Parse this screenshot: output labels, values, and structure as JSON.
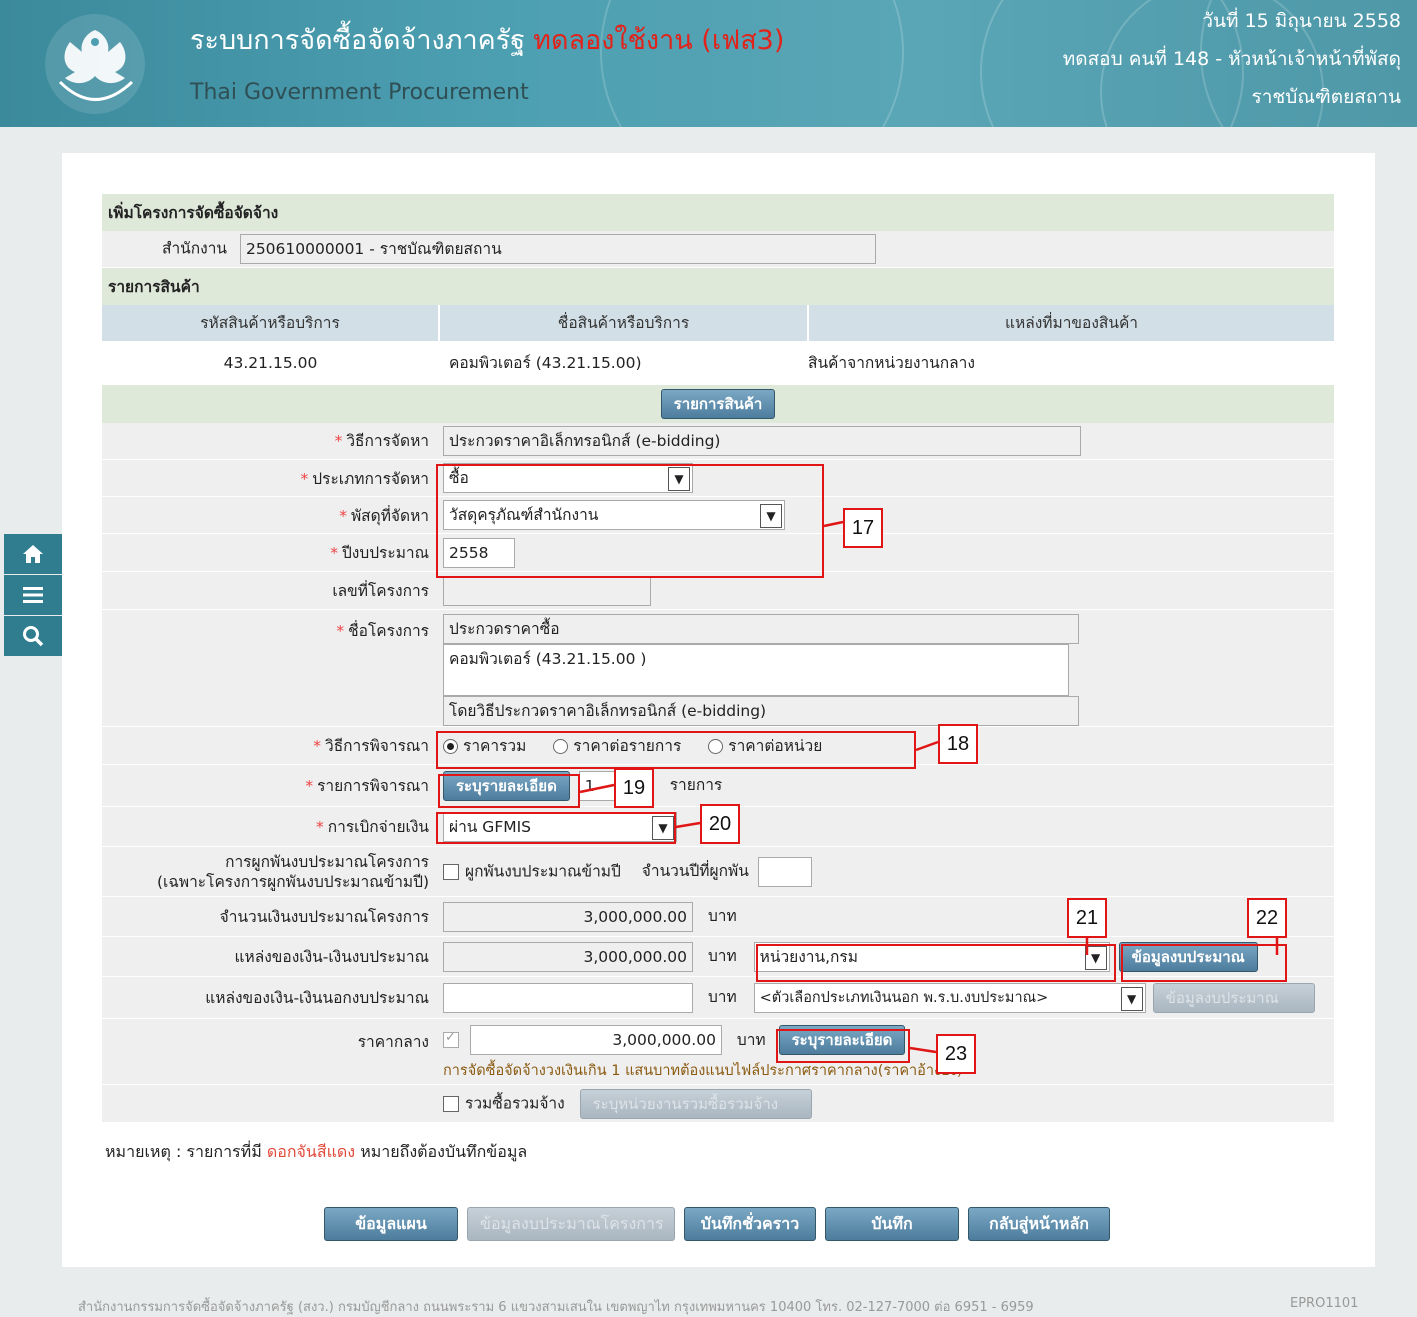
{
  "header": {
    "title_th": "ระบบการจัดซื้อจัดจ้างภาครัฐ",
    "trial_label": "ทดลองใช้งาน (เฟส3)",
    "title_en": "Thai Government Procurement",
    "date": "วันที่ 15 มิถุนายน 2558",
    "user": "ทดสอบ คนที่ 148 - หัวหน้าเจ้าหน้าที่พัสดุ",
    "org": "ราชบัณฑิตยสถาน"
  },
  "form": {
    "section_title": "เพิ่มโครงการจัดซื้อจัดจ้าง",
    "office_label": "สำนักงาน",
    "office_value": "250610000001 - ราชบัณฑิตยสถาน",
    "items_section": "รายการสินค้า",
    "product_headers": [
      "รหัสสินค้าหรือบริการ",
      "ชื่อสินค้าหรือบริการ",
      "แหล่งที่มาของสินค้า"
    ],
    "product_row": {
      "code": "43.21.15.00",
      "name": "คอมพิวเตอร์ (43.21.15.00)",
      "source": "สินค้าจากหน่วยงานกลาง"
    },
    "product_list_button": "รายการสินค้า",
    "method_label": "วิธีการจัดหา",
    "method_value": "ประกวดราคาอิเล็กทรอนิกส์ (e-bidding)",
    "type_label": "ประเภทการจัดหา",
    "type_value": "ซื้อ",
    "supply_label": "พัสดุที่จัดหา",
    "supply_value": "วัสดุครุภัณฑ์สำนักงาน",
    "year_label": "ปีงบประมาณ",
    "year_value": "2558",
    "project_no_label": "เลขที่โครงการ",
    "project_no_value": "",
    "project_name_label": "ชื่อโครงการ",
    "project_name_1": "ประกวดราคาซื้อ",
    "project_name_2": "คอมพิวเตอร์ (43.21.15.00 )",
    "project_name_3": "โดยวิธีประกวดราคาอิเล็กทรอนิกส์ (e-bidding)",
    "consider_label": "วิธีการพิจารณา",
    "consider_opt1": "ราคารวม",
    "consider_opt2": "ราคาต่อรายการ",
    "consider_opt3": "ราคาต่อหน่วย",
    "consider_items_label": "รายการพิจารณา",
    "detail_button": "ระบุรายละเอียด",
    "consider_count": "1",
    "consider_unit": "รายการ",
    "payment_label": "การเบิกจ่ายเงิน",
    "payment_value": "ผ่าน GFMIS",
    "commit_label": "การผูกพันงบประมาณโครงการ",
    "commit_sub": "(เฉพาะโครงการผูกพันงบประมาณข้ามปี)",
    "commit_check": "ผูกพันงบประมาณข้ามปี",
    "commit_years_label": "จำนวนปีที่ผูกพัน",
    "budget_label": "จำนวนเงินงบประมาณโครงการ",
    "budget_value": "3,000,000.00",
    "baht": "บาท",
    "source_budget_label": "แหล่งของเงิน-เงินงบประมาณ",
    "source_budget_value": "3,000,000.00",
    "source_budget_select": "หน่วยงาน,กรม",
    "budget_info_button": "ข้อมูลงบประมาณ",
    "source_off_label": "แหล่งของเงิน-เงินนอกงบประมาณ",
    "source_off_select": "<ตัวเลือกประเภทเงินนอก พ.ร.บ.งบประมาณ>",
    "budget_info_button_disabled": "ข้อมูลงบประมาณ",
    "median_label": "ราคากลาง",
    "median_value": "3,000,000.00",
    "median_note": "การจัดซื้อจัดจ้างวงเงินเกิน 1 แสนบาทต้องแนบไฟล์ประกาศราคากลาง(ราคาอ้างอิง)",
    "joint_check": "รวมซื้อรวมจ้าง",
    "joint_button": "ระบุหน่วยงานรวมซื้อรวมจ้าง"
  },
  "note": {
    "prefix": "หมายเหตุ : รายการที่มี ",
    "red": "ดอกจันสีแดง",
    "suffix": " หมายถึงต้องบันทึกข้อมูล"
  },
  "buttons": {
    "plan": "ข้อมูลแผน",
    "project_budget": "ข้อมูลงบประมาณโครงการ",
    "save_draft": "บันทึกชั่วคราว",
    "save": "บันทึก",
    "back": "กลับสู่หน้าหลัก"
  },
  "annotations": [
    "17",
    "18",
    "19",
    "20",
    "21",
    "22",
    "23"
  ],
  "footer": {
    "text": "สำนักงานกรรมการจัดซื้อจัดจ้างภาครัฐ (สงว.) กรมบัญชีกลาง ถนนพระราม 6 แขวงสามเสนใน เขตพญาไท กรุงเทพมหานคร 10400 โทร. 02-127-7000 ต่อ 6951 - 6959",
    "code": "EPRO1101"
  },
  "colors": {
    "header_bg": "#4c9fb1",
    "trial_red": "#e2231a",
    "annotation_red": "#e01515",
    "section_green": "#dfe9da"
  },
  "icons": [
    "home-icon",
    "menu-icon",
    "search-icon",
    "garuda-logo"
  ]
}
